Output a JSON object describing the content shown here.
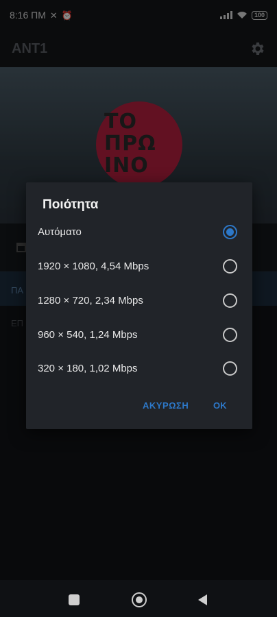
{
  "status_bar": {
    "time": "8:16 ΠΜ",
    "battery": "100"
  },
  "app_bar": {
    "title": "ANT1"
  },
  "hero": {
    "logo_lines": [
      "ΤΟ",
      "ΠΡΩ",
      "ΙΝΟ"
    ]
  },
  "background_list": {
    "item1": "ΠΑ",
    "item2": "ΕΠ"
  },
  "dialog": {
    "title": "Ποιότητα",
    "options": [
      {
        "label": "Αυτόματο",
        "selected": true
      },
      {
        "label": "1920 × 1080, 4,54 Mbps",
        "selected": false
      },
      {
        "label": "1280 × 720, 2,34 Mbps",
        "selected": false
      },
      {
        "label": "960 × 540, 1,24 Mbps",
        "selected": false
      },
      {
        "label": "320 × 180, 1,02 Mbps",
        "selected": false
      }
    ],
    "cancel_label": "ΑΚΥΡΩΣΗ",
    "ok_label": "OK"
  },
  "colors": {
    "accent": "#2d78c8",
    "logo": "#b21f3f"
  }
}
